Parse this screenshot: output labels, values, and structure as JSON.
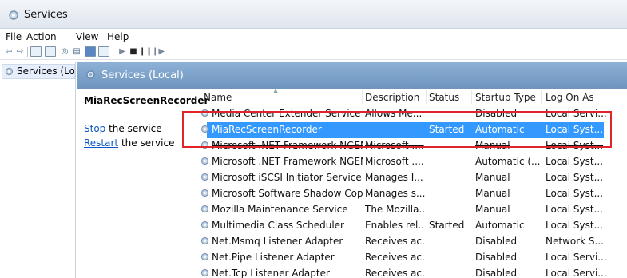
{
  "window": {
    "title": "Services"
  },
  "menu": [
    "File",
    "Action",
    "View",
    "Help"
  ],
  "tree": {
    "item": "Services (Lo"
  },
  "header": {
    "title": "Services (Local)"
  },
  "detail": {
    "service_name": "MiaRecScreenRecorder",
    "stop_link": "Stop",
    "stop_rest": " the service",
    "restart_link": "Restart",
    "restart_rest": " the service"
  },
  "columns": {
    "name": "Name",
    "description": "Description",
    "status": "Status",
    "startup": "Startup Type",
    "logon": "Log On As"
  },
  "rows": [
    {
      "name": "Media Center Extender Service",
      "description": "Allows Me...",
      "status": "",
      "startup": "Disabled",
      "logon": "Local Servi..."
    },
    {
      "name": "MiaRecScreenRecorder",
      "description": "",
      "status": "Started",
      "startup": "Automatic",
      "logon": "Local Syst..."
    },
    {
      "name": "Microsoft .NET Framework NGEN...",
      "description": "Microsoft ....",
      "status": "",
      "startup": "Manual",
      "logon": "Local Syst..."
    },
    {
      "name": "Microsoft .NET Framework NGEN...",
      "description": "Microsoft ....",
      "status": "",
      "startup": "Automatic (...",
      "logon": "Local Syst..."
    },
    {
      "name": "Microsoft iSCSI Initiator Service",
      "description": "Manages I...",
      "status": "",
      "startup": "Manual",
      "logon": "Local Syst..."
    },
    {
      "name": "Microsoft Software Shadow Cop...",
      "description": "Manages s...",
      "status": "",
      "startup": "Manual",
      "logon": "Local Syst..."
    },
    {
      "name": "Mozilla Maintenance Service",
      "description": "The Mozilla...",
      "status": "",
      "startup": "Manual",
      "logon": "Local Syst..."
    },
    {
      "name": "Multimedia Class Scheduler",
      "description": "Enables rel...",
      "status": "Started",
      "startup": "Automatic",
      "logon": "Local Syst..."
    },
    {
      "name": "Net.Msmq Listener Adapter",
      "description": "Receives ac...",
      "status": "",
      "startup": "Disabled",
      "logon": "Network S..."
    },
    {
      "name": "Net.Pipe Listener Adapter",
      "description": "Receives ac...",
      "status": "",
      "startup": "Disabled",
      "logon": "Local Servi..."
    },
    {
      "name": "Net.Tcp Listener Adapter",
      "description": "Receives ac...",
      "status": "",
      "startup": "Disabled",
      "logon": "Local Servi..."
    }
  ],
  "selected_row_index": 1,
  "colors": {
    "selection": "#3399ff",
    "highlight_box": "#e0252a",
    "header_band": "#7da3cb",
    "link": "#0b56c4"
  }
}
